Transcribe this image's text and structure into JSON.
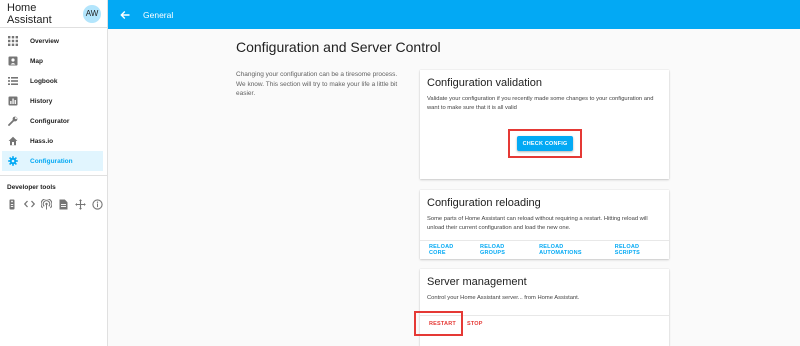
{
  "sidebar": {
    "title": "Home Assistant",
    "avatar": "AW",
    "items": [
      {
        "label": "Overview",
        "icon": "grid-icon"
      },
      {
        "label": "Map",
        "icon": "map-icon"
      },
      {
        "label": "Logbook",
        "icon": "list-icon"
      },
      {
        "label": "History",
        "icon": "chart-icon"
      },
      {
        "label": "Configurator",
        "icon": "wrench-icon"
      },
      {
        "label": "Hass.io",
        "icon": "home-icon"
      },
      {
        "label": "Configuration",
        "icon": "gear-icon",
        "active": true
      }
    ],
    "dev_tools_title": "Developer tools",
    "dev_tools": [
      "remote-icon",
      "code-icon",
      "antenna-icon",
      "file-icon",
      "move-icon",
      "info-icon"
    ]
  },
  "topbar": {
    "title": "General"
  },
  "page": {
    "title": "Configuration and Server Control",
    "intro": "Changing your configuration can be a tiresome process. We know. This section will try to make your life a little bit easier."
  },
  "validation": {
    "title": "Configuration validation",
    "text": "Validate your configuration if you recently made some changes to your configuration and want to make sure that it is all valid",
    "button": "CHECK CONFIG"
  },
  "reloading": {
    "title": "Configuration reloading",
    "text": "Some parts of Home Assistant can reload without requiring a restart. Hitting reload will unload their current configuration and load the new one.",
    "actions": [
      "RELOAD CORE",
      "RELOAD GROUPS",
      "RELOAD AUTOMATIONS",
      "RELOAD SCRIPTS"
    ]
  },
  "server": {
    "title": "Server management",
    "text": "Control your Home Assistant server... from Home Assistant.",
    "restart": "RESTART",
    "stop": "STOP"
  },
  "colors": {
    "accent": "#03a9f4",
    "highlight": "#e53935"
  }
}
